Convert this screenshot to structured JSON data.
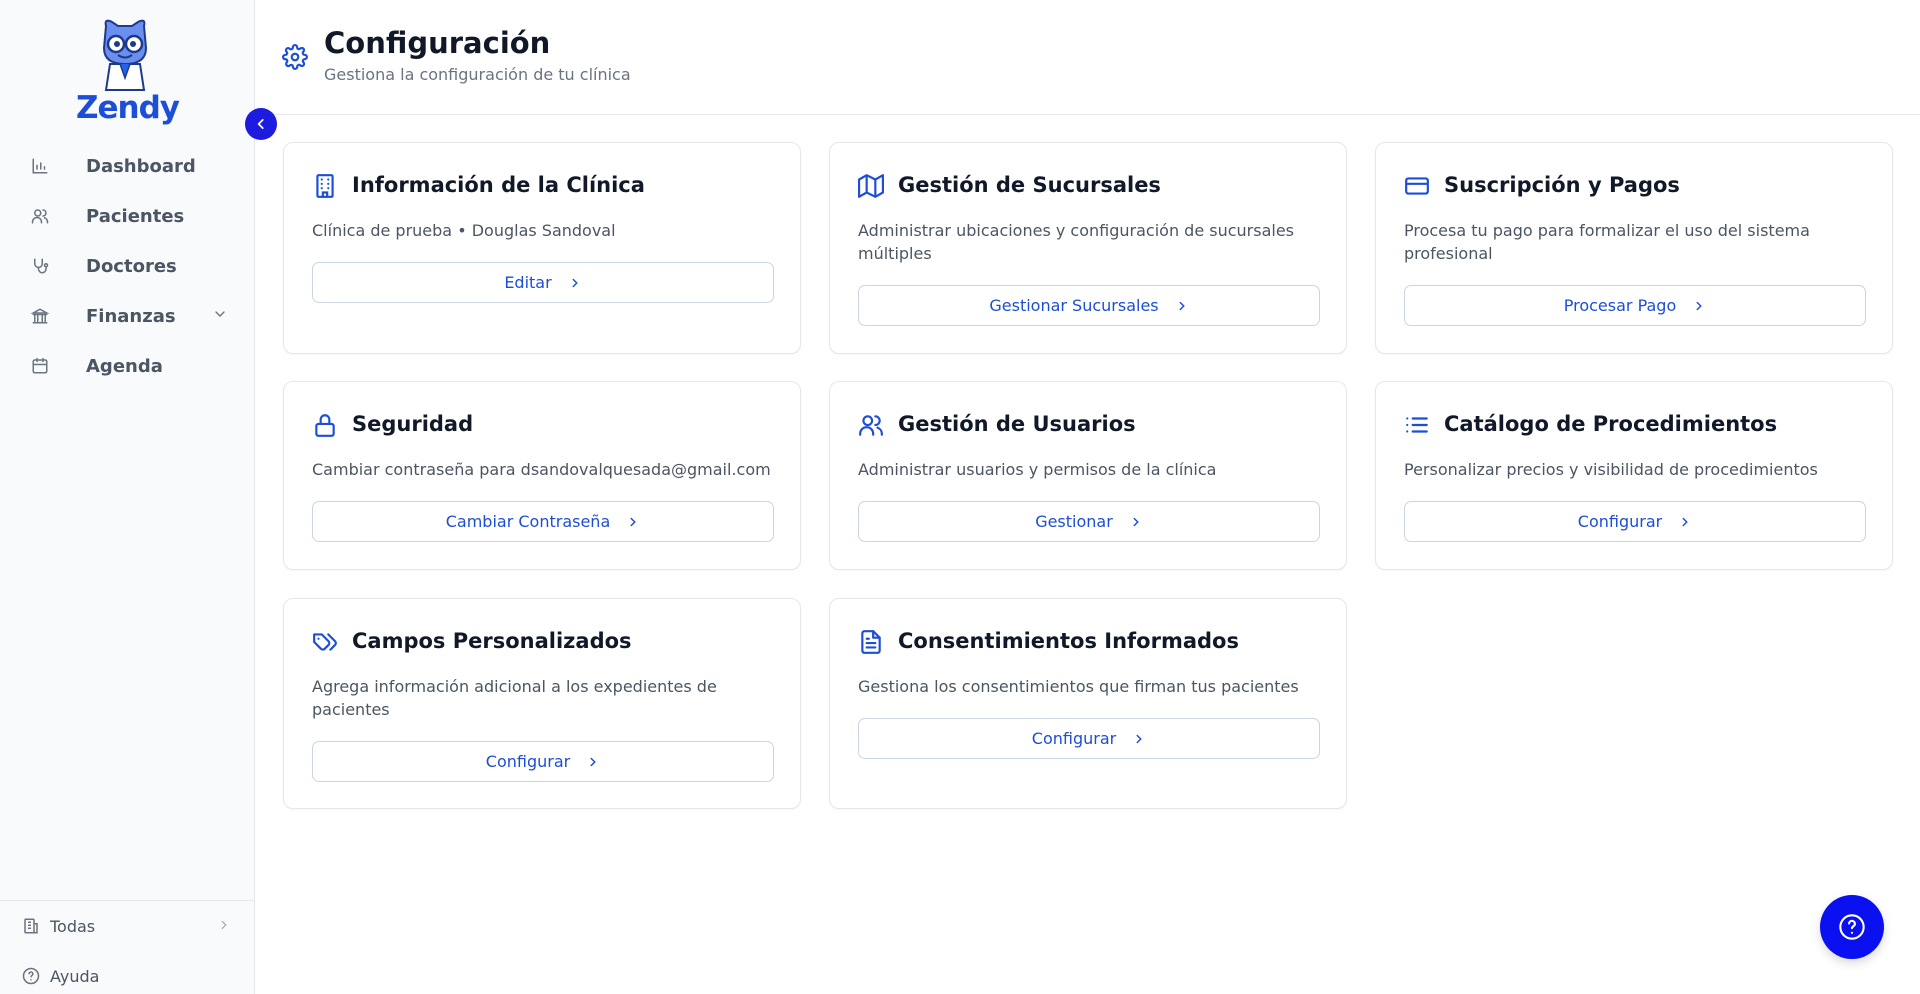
{
  "app": {
    "brand": "Zendy"
  },
  "sidebar": {
    "items": [
      {
        "label": "Dashboard",
        "icon": "bar-chart-icon"
      },
      {
        "label": "Pacientes",
        "icon": "users-icon"
      },
      {
        "label": "Doctores",
        "icon": "stethoscope-icon"
      },
      {
        "label": "Finanzas",
        "icon": "bank-icon",
        "has_submenu": true
      },
      {
        "label": "Agenda",
        "icon": "calendar-icon"
      }
    ],
    "footer": [
      {
        "label": "Todas",
        "icon": "buildings-icon"
      },
      {
        "label": "Ayuda",
        "icon": "help-circle-icon"
      }
    ]
  },
  "header": {
    "title": "Configuración",
    "subtitle": "Gestiona la configuración de tu clínica"
  },
  "cards": [
    {
      "title": "Información de la Clínica",
      "description": "Clínica de prueba • Douglas Sandoval",
      "button": "Editar",
      "icon": "building-icon"
    },
    {
      "title": "Gestión de Sucursales",
      "description": "Administrar ubicaciones y configuración de sucursales múltiples",
      "button": "Gestionar Sucursales",
      "icon": "map-icon"
    },
    {
      "title": "Suscripción y Pagos",
      "description": "Procesa tu pago para formalizar el uso del sistema profesional",
      "button": "Procesar Pago",
      "icon": "credit-card-icon"
    },
    {
      "title": "Seguridad",
      "description": "Cambiar contraseña para dsandovalquesada@gmail.com",
      "button": "Cambiar Contraseña",
      "icon": "lock-icon"
    },
    {
      "title": "Gestión de Usuarios",
      "description": "Administrar usuarios y permisos de la clínica",
      "button": "Gestionar",
      "icon": "users-icon"
    },
    {
      "title": "Catálogo de Procedimientos",
      "description": "Personalizar precios y visibilidad de procedimientos",
      "button": "Configurar",
      "icon": "list-icon"
    },
    {
      "title": "Campos Personalizados",
      "description": "Agrega información adicional a los expedientes de pacientes",
      "button": "Configurar",
      "icon": "tags-icon"
    },
    {
      "title": "Consentimientos Informados",
      "description": "Gestiona los consentimientos que firman tus pacientes",
      "button": "Configurar",
      "icon": "document-icon"
    }
  ],
  "colors": {
    "accent": "#1d4ed8",
    "help_button": "#0a10f0",
    "collapse_button": "#1d1be0"
  }
}
